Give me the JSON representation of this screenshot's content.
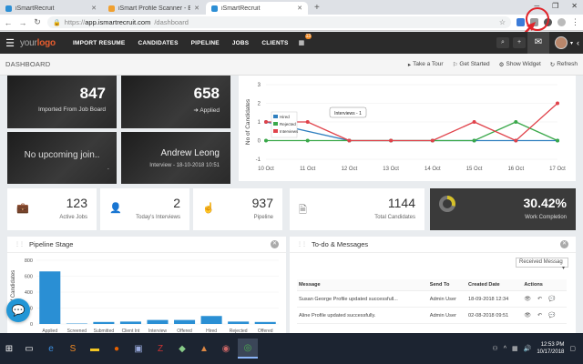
{
  "browser": {
    "tabs": [
      {
        "label": "iSmartRecruit",
        "active": false
      },
      {
        "label": "iSmart Profile Scanner - Edit Item",
        "active": false
      },
      {
        "label": "iSmartRecruit",
        "active": true
      }
    ],
    "new_tab": "+",
    "url_scheme": "https://",
    "url_host": "app.ismartrecruit.com",
    "url_path": "/dashboard"
  },
  "nav": {
    "logo_main": "your",
    "logo_accent": "logo",
    "items": [
      "IMPORT RESUME",
      "CANDIDATES",
      "PIPELINE",
      "JOBS",
      "CLIENTS"
    ],
    "calendar_badge": "13"
  },
  "subheader": {
    "title": "DASHBOARD",
    "actions": [
      "Take a Tour",
      "Get Started",
      "Show Widget",
      "Refresh"
    ]
  },
  "tiles": {
    "imported_value": "847",
    "imported_label": "Imported From Job Board",
    "applied_value": "658",
    "applied_label": "Applied",
    "no_upcoming": "No upcoming join..",
    "no_upcoming_dot": ".",
    "person_name": "Andrew Leong",
    "person_detail": "Interview - 18-10-2018 10:51"
  },
  "chart_data": [
    {
      "type": "line",
      "ylabel": "No of Candidates",
      "x": [
        "10 Oct",
        "11 Oct",
        "12 Oct",
        "13 Oct",
        "14 Oct",
        "15 Oct",
        "16 Oct",
        "17 Oct"
      ],
      "ylim": [
        -1,
        3
      ],
      "yticks": [
        3,
        2,
        1,
        0,
        -1
      ],
      "legend": "top-left",
      "tooltip": "Interviews - 1",
      "series": [
        {
          "name": "Hired",
          "color": "#2f7fbf",
          "values": [
            1,
            null,
            0,
            0,
            0,
            0,
            0,
            0
          ]
        },
        {
          "name": "Rejected",
          "color": "#3aa84a",
          "values": [
            0,
            0,
            0,
            0,
            0,
            0,
            1,
            0
          ]
        },
        {
          "name": "Interviews",
          "color": "#e0424a",
          "values": [
            1,
            1,
            0,
            0,
            0,
            1,
            0,
            2
          ]
        }
      ]
    },
    {
      "type": "bar",
      "title": "Pipeline Stage",
      "ylabel": "No of Candidates",
      "ylim": [
        0,
        800
      ],
      "yticks": [
        800,
        600,
        400,
        200,
        0
      ],
      "categories": [
        "Applied",
        "Screened",
        "Submitted",
        "Client Int",
        "Interview",
        "Offered",
        "Hired",
        "Rejected",
        "Offered"
      ],
      "values": [
        660,
        5,
        25,
        30,
        50,
        50,
        100,
        30,
        25
      ]
    }
  ],
  "stats": [
    {
      "icon": "briefcase-icon",
      "value": "123",
      "label": "Active Jobs"
    },
    {
      "icon": "user-icon",
      "value": "2",
      "label": "Today's Interviews"
    },
    {
      "icon": "pointer-icon",
      "value": "937",
      "label": "Pipeline"
    },
    {
      "icon": "document-icon",
      "value": "1144",
      "label": "Total Candidates"
    },
    {
      "icon": "donut-icon",
      "value": "30.42%",
      "label": "Work Completion",
      "fraction": 0.3042
    }
  ],
  "todo": {
    "title": "To-do & Messages",
    "filter": "Received Messag",
    "columns": [
      "Message",
      "Send To",
      "Created Date",
      "Actions"
    ],
    "rows": [
      {
        "message": "Susan George Profile updated successfull...",
        "send_to": "Admin User",
        "date": "18-09-2018 12:34"
      },
      {
        "message": "Aline Profile updated successfully.",
        "send_to": "Admin User",
        "date": "02-08-2018 09:51"
      }
    ]
  },
  "taskbar": {
    "time": "12:53 PM",
    "date": "10/17/2018"
  },
  "colors": {
    "accent": "#f08a24",
    "annotation": "#e0242a"
  }
}
